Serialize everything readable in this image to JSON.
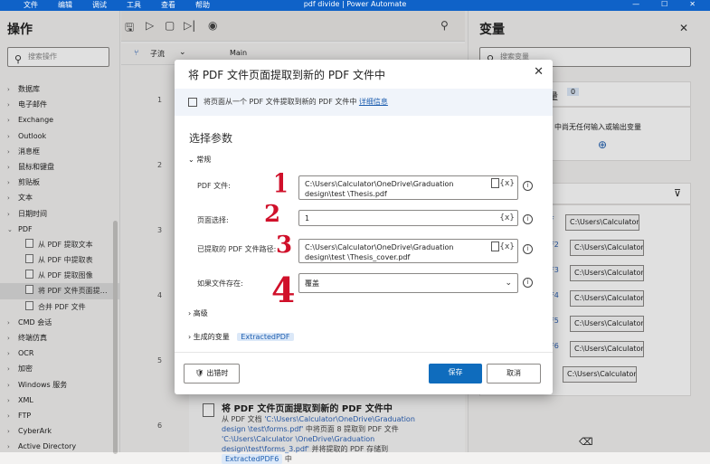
{
  "menubar": {
    "items": [
      "文件",
      "编辑",
      "调试",
      "工具",
      "查看",
      "帮助"
    ],
    "title": "pdf divide | Power Automate"
  },
  "actions_panel": {
    "title": "操作",
    "search_placeholder": "搜索操作",
    "categories": [
      "数据库",
      "电子邮件",
      "Exchange",
      "Outlook",
      "消息框",
      "鼠标和键盘",
      "剪贴板",
      "文本",
      "日期时间",
      "PDF"
    ],
    "pdf_children": [
      "从 PDF 提取文本",
      "从 PDF 中提取表",
      "从 PDF 提取图像",
      "将 PDF 文件页面提…",
      "合并 PDF 文件"
    ],
    "more_categories": [
      "CMD 会话",
      "终端仿真",
      "OCR",
      "加密",
      "Windows 服务",
      "XML",
      "FTP",
      "CyberArk",
      "Active Directory"
    ]
  },
  "editor": {
    "subflows_label": "子流",
    "main_tab": "Main",
    "line_numbers": [
      "1",
      "2",
      "3",
      "4",
      "5",
      "6"
    ]
  },
  "behind_step": {
    "title": "将 PDF 文件页面提取到新的 PDF 文件中",
    "desc_1": "从 PDF 文档 ",
    "path_1": "'C:\\Users\\Calculator\\OneDrive\\Graduation design \\test\\forms.pdf'",
    "desc_2": " 中将页面 8 提取到 PDF 文件 ",
    "path_2": "'C:\\Users\\Calculator \\OneDrive\\Graduation design\\test\\forms_3.pdf'",
    "desc_3": " 并将提取的 PDF 存储到 ",
    "var": "ExtractedPDF6",
    "desc_4": " 中"
  },
  "variables_panel": {
    "title": "变量",
    "search_placeholder": "搜索变量",
    "count": "0",
    "count_label_part": "量",
    "empty_text": "中尚无任何输入或输出变量",
    "var_labels": [
      "DF",
      "DF2",
      "DF3",
      "DF4",
      "DF5",
      "DF6"
    ],
    "var_values": [
      "C:\\Users\\Calculator...",
      "C:\\Users\\Calculator...",
      "C:\\Users\\Calculator...",
      "C:\\Users\\Calculator...",
      "C:\\Users\\Calculator...",
      "C:\\Users\\Calculator...",
      "C:\\Users\\Calculator..."
    ]
  },
  "dialog": {
    "title": "将 PDF 文件页面提取到新的 PDF 文件中",
    "info_text": "将页面从一个 PDF 文件提取到新的 PDF 文件中",
    "info_link": "详细信息",
    "section": "选择参数",
    "general": "常规",
    "fields": {
      "pdf_file_label": "PDF 文件:",
      "pdf_file_value": "C:\\Users\\Calculator\\OneDrive\\Graduation design\\test \\Thesis.pdf",
      "page_sel_label": "页面选择:",
      "page_sel_value": "1",
      "out_path_label": "已提取的 PDF 文件路径:",
      "out_path_value": "C:\\Users\\Calculator\\OneDrive\\Graduation design\\test \\Thesis_cover.pdf",
      "exists_label": "如果文件存在:",
      "exists_value": "覆盖"
    },
    "advanced": "高级",
    "generated_vars": "生成的变量",
    "generated_var_chip": "ExtractedPDF",
    "on_error": "出错时",
    "save": "保存",
    "cancel": "取消",
    "var_token": "{x}"
  },
  "annotations": [
    "1",
    "2",
    "3",
    "4"
  ],
  "colors": {
    "accent": "#0f6cbd",
    "title_bar": "#0f62c8",
    "annotation": "#d0102a"
  }
}
